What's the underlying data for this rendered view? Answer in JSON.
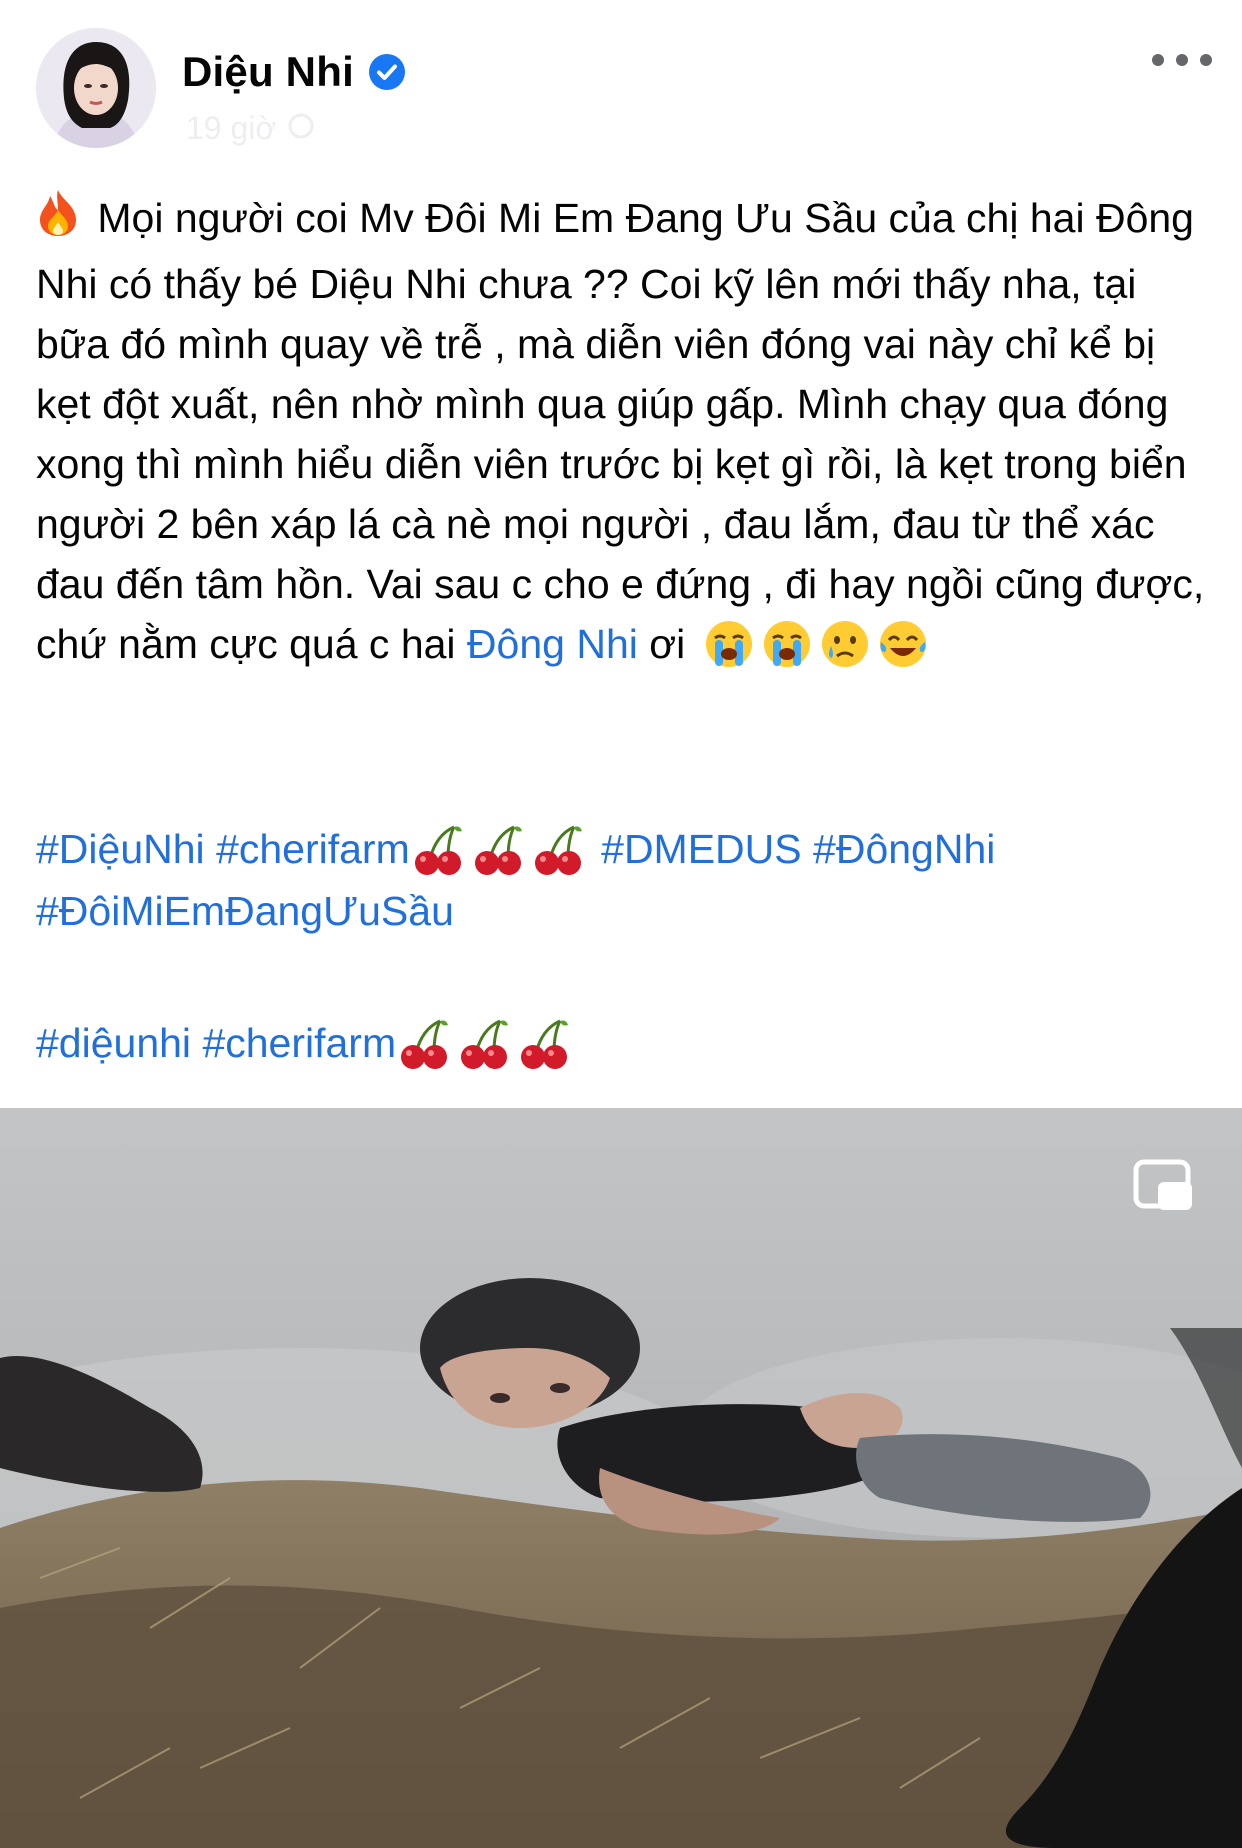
{
  "post": {
    "author": "Diệu Nhi",
    "timestamp": "19 giờ",
    "paragraph": {
      "line1": "Mọi người coi Mv Đôi Mi Em Đang Ưu Sầu của chị hai Đông Nhi có thấy bé Diệu Nhi chưa ?? Coi kỹ lên mới thấy nha, tại bữa đó mình quay về trễ , mà diễn viên đóng vai này chỉ kể bị kẹt đột xuất, nên nhờ mình qua giúp gấp. Mình chạy qua đóng xong thì mình hiểu diễn viên trước bị kẹt gì rồi, là kẹt trong biển người 2 bên xáp lá cà nè mọi người , đau lắm, đau từ thể xác đau đến tâm hồn. Vai sau c cho e đứng , đi hay ngồi cũng được, chứ nằm cực quá c hai ",
      "mention": "Đông Nhi",
      "after_mention": " ơi"
    },
    "hashtags_row1": {
      "tag1": "#DiệuNhi",
      "tag2": "#cherifarm",
      "tag3": "#DMEDUS",
      "tag4": "#ĐôngNhi",
      "tag5": "#ĐôiMiEmĐangƯuSầu"
    },
    "hashtags_row2": {
      "tag1": "#diệunhi",
      "tag2": "#cherifarm"
    }
  },
  "icons": {
    "verified": "verified-badge-icon",
    "more": "more-options-icon",
    "fire": "fire-emoji",
    "crying": "loudly-crying-face-emoji",
    "sad_tear": "crying-face-emoji",
    "joy": "tears-of-joy-emoji",
    "cherries": "cherries-emoji",
    "pip": "picture-in-picture-icon"
  },
  "colors": {
    "link": "#216fdb",
    "verified": "#1877f2",
    "text": "#050505"
  }
}
